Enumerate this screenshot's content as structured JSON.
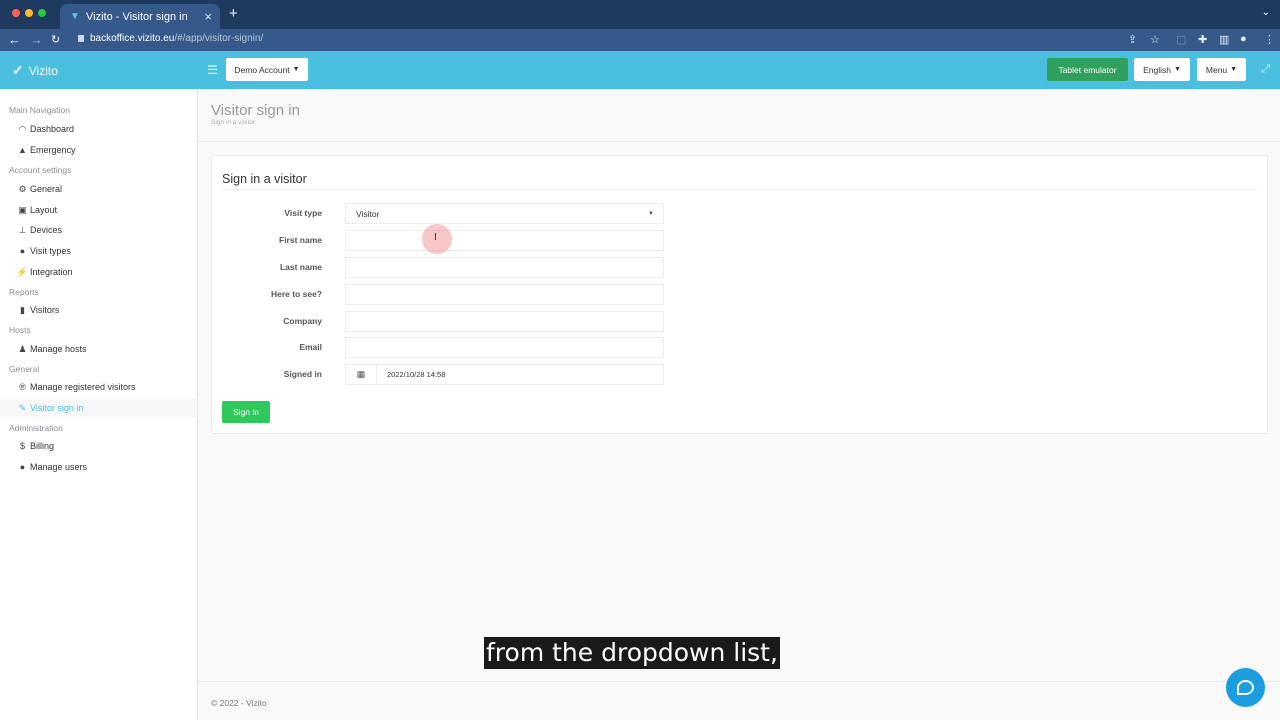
{
  "browser": {
    "tab_title": "Vizito - Visitor sign in",
    "url_host": "backoffice.vizito.eu",
    "url_path": "/#/app/visitor-signin/"
  },
  "header": {
    "logo_text": "Vizito",
    "account_button": "Demo Account",
    "tablet_emulator": "Tablet emulator",
    "language": "English",
    "menu": "Menu"
  },
  "sidebar": {
    "sections": [
      {
        "label": "Main Navigation"
      },
      {
        "label": "Account settings"
      },
      {
        "label": "Reports"
      },
      {
        "label": "Hosts"
      },
      {
        "label": "General"
      },
      {
        "label": "Administration"
      }
    ],
    "items": [
      {
        "label": "Dashboard",
        "icon": "dashboard-icon"
      },
      {
        "label": "Emergency",
        "icon": "warning-icon"
      },
      {
        "label": "General",
        "icon": "gear-icon"
      },
      {
        "label": "Layout",
        "icon": "image-icon"
      },
      {
        "label": "Devices",
        "icon": "sitemap-icon"
      },
      {
        "label": "Visit types",
        "icon": "users-icon"
      },
      {
        "label": "Integration",
        "icon": "plug-icon"
      },
      {
        "label": "Visitors",
        "icon": "book-icon"
      },
      {
        "label": "Manage hosts",
        "icon": "user-icon"
      },
      {
        "label": "Manage registered visitors",
        "icon": "registered-icon"
      },
      {
        "label": "Visitor sign in",
        "icon": "pencil-icon",
        "active": true
      },
      {
        "label": "Billing",
        "icon": "dollar-icon"
      },
      {
        "label": "Manage users",
        "icon": "users-icon"
      }
    ]
  },
  "page": {
    "title": "Visitor sign in",
    "subtitle": "Sign in a visitor"
  },
  "form": {
    "panel_title": "Sign in a visitor",
    "fields": {
      "visit_type": {
        "label": "Visit type",
        "value": "Visitor"
      },
      "first_name": {
        "label": "First name",
        "value": ""
      },
      "last_name": {
        "label": "Last name",
        "value": ""
      },
      "here_to_see": {
        "label": "Here to see?",
        "value": ""
      },
      "company": {
        "label": "Company",
        "value": ""
      },
      "email": {
        "label": "Email",
        "value": ""
      },
      "signed_in": {
        "label": "Signed in",
        "value": "2022/10/28 14:58"
      }
    },
    "submit_label": "Sign in"
  },
  "footer": {
    "text": "© 2022 - Vizito"
  },
  "caption": {
    "text": "from the dropdown list,"
  },
  "colors": {
    "accent": "#4bbfe0",
    "header_bg": "#4bbfe0",
    "success": "#2fc85a",
    "tablet_btn": "#2fa05e",
    "chat": "#1b9ee0"
  }
}
